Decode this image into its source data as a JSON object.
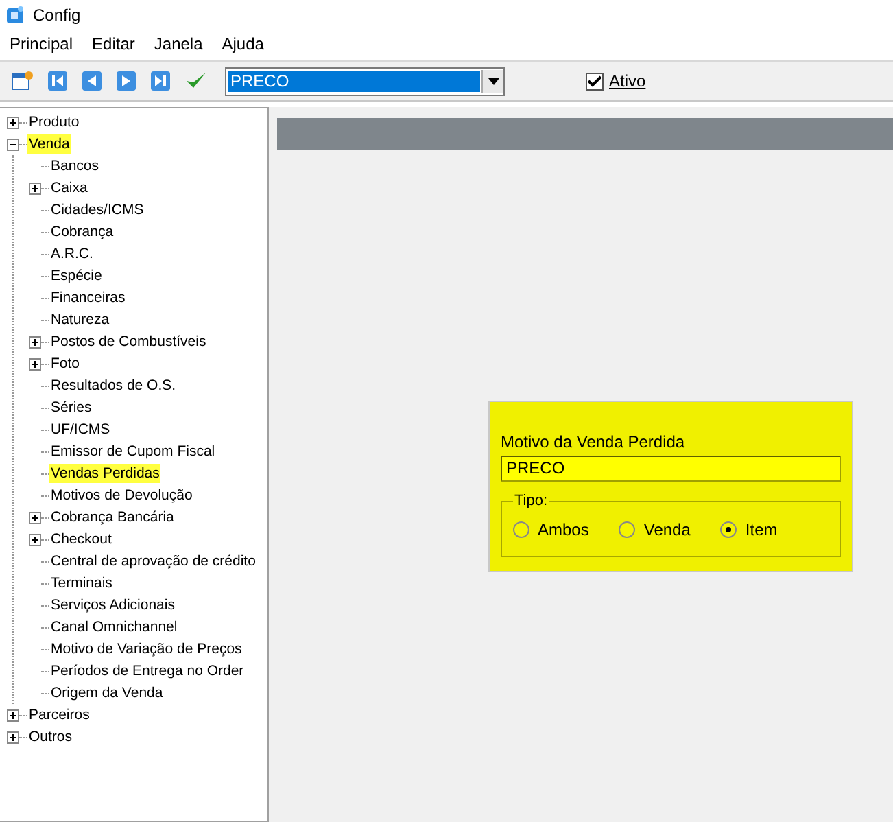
{
  "window": {
    "title": "Config"
  },
  "menu": [
    "Principal",
    "Editar",
    "Janela",
    "Ajuda"
  ],
  "toolbar": {
    "combo_value": "PRECO",
    "ativo": {
      "label": "Ativo",
      "checked": true
    }
  },
  "tree": [
    {
      "label": "Produto",
      "expanded": false,
      "selected": false
    },
    {
      "label": "Venda",
      "expanded": true,
      "selected": true,
      "children": [
        {
          "label": "Bancos",
          "selected": false
        },
        {
          "label": "Caixa",
          "expanded": false,
          "selected": false
        },
        {
          "label": "Cidades/ICMS",
          "selected": false
        },
        {
          "label": "Cobrança",
          "selected": false
        },
        {
          "label": "A.R.C.",
          "selected": false
        },
        {
          "label": "Espécie",
          "selected": false
        },
        {
          "label": "Financeiras",
          "selected": false
        },
        {
          "label": "Natureza",
          "selected": false
        },
        {
          "label": "Postos de Combustíveis",
          "expanded": false,
          "selected": false
        },
        {
          "label": "Foto",
          "expanded": false,
          "selected": false
        },
        {
          "label": "Resultados de O.S.",
          "selected": false
        },
        {
          "label": "Séries",
          "selected": false
        },
        {
          "label": "UF/ICMS",
          "selected": false
        },
        {
          "label": "Emissor de Cupom Fiscal",
          "selected": false
        },
        {
          "label": "Vendas Perdidas",
          "selected": true
        },
        {
          "label": "Motivos de Devolução",
          "selected": false
        },
        {
          "label": "Cobrança Bancária",
          "expanded": false,
          "selected": false
        },
        {
          "label": "Checkout",
          "expanded": false,
          "selected": false
        },
        {
          "label": "Central de aprovação de crédito",
          "selected": false
        },
        {
          "label": "Terminais",
          "selected": false
        },
        {
          "label": "Serviços Adicionais",
          "selected": false
        },
        {
          "label": "Canal Omnichannel",
          "selected": false
        },
        {
          "label": "Motivo de Variação de Preços",
          "selected": false
        },
        {
          "label": "Períodos de Entrega no Order",
          "selected": false
        },
        {
          "label": "Origem da Venda",
          "selected": false
        }
      ]
    },
    {
      "label": "Parceiros",
      "expanded": false,
      "selected": false
    },
    {
      "label": "Outros",
      "expanded": false,
      "selected": false
    }
  ],
  "form": {
    "field_label": "Motivo da Venda Perdida",
    "field_value": "PRECO",
    "group_label": "Tipo:",
    "options": [
      {
        "label": "Ambos",
        "selected": false
      },
      {
        "label": "Venda",
        "selected": false
      },
      {
        "label": "Item",
        "selected": true
      }
    ]
  }
}
